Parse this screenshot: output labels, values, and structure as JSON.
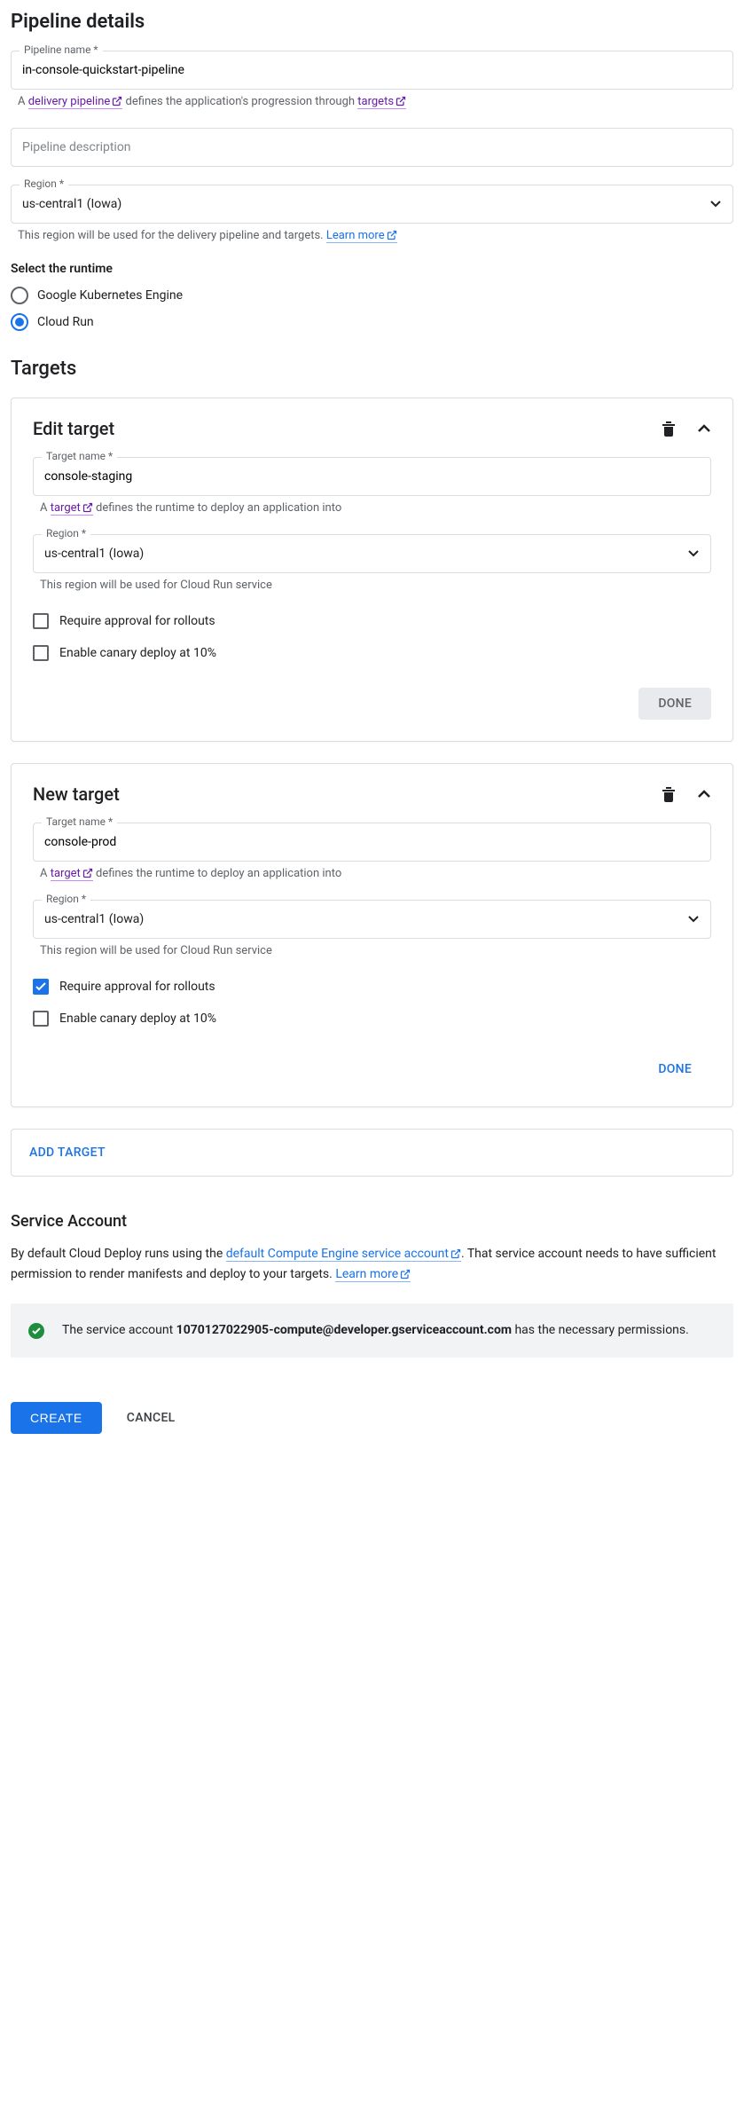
{
  "header": {
    "title": "Pipeline details"
  },
  "pipelineName": {
    "label": "Pipeline name *",
    "value": "in-console-quickstart-pipeline"
  },
  "pipelineHelper": {
    "prefix": "A ",
    "link1": "delivery pipeline",
    "mid": " defines the application's progression through ",
    "link2": "targets"
  },
  "pipelineDescription": {
    "placeholder": "Pipeline description"
  },
  "region": {
    "label": "Region *",
    "value": "us-central1 (Iowa)",
    "helperPrefix": "This region will be used for the delivery pipeline and targets. ",
    "helperLink": "Learn more"
  },
  "runtime": {
    "heading": "Select the runtime",
    "options": [
      {
        "label": "Google Kubernetes Engine",
        "selected": false
      },
      {
        "label": "Cloud Run",
        "selected": true
      }
    ]
  },
  "targetsHeading": "Targets",
  "targets": [
    {
      "cardTitle": "Edit target",
      "nameLabel": "Target name *",
      "nameValue": "console-staging",
      "helperPrefix": "A ",
      "helperLink": "target",
      "helperSuffix": " defines the runtime to deploy an application into",
      "regionLabel": "Region *",
      "regionValue": "us-central1 (Iowa)",
      "regionHelper": "This region will be used for Cloud Run service",
      "requireApproval": {
        "label": "Require approval for rollouts",
        "checked": false
      },
      "enableCanary": {
        "label": "Enable canary deploy at 10%",
        "checked": false
      },
      "doneLabel": "DONE",
      "doneDisabled": true
    },
    {
      "cardTitle": "New target",
      "nameLabel": "Target name *",
      "nameValue": "console-prod",
      "helperPrefix": "A ",
      "helperLink": "target",
      "helperSuffix": " defines the runtime to deploy an application into",
      "regionLabel": "Region *",
      "regionValue": "us-central1 (Iowa)",
      "regionHelper": "This region will be used for Cloud Run service",
      "requireApproval": {
        "label": "Require approval for rollouts",
        "checked": true
      },
      "enableCanary": {
        "label": "Enable canary deploy at 10%",
        "checked": false
      },
      "doneLabel": "DONE",
      "doneDisabled": false
    }
  ],
  "addTargetLabel": "ADD TARGET",
  "serviceAccount": {
    "heading": "Service Account",
    "textPrefix": "By default Cloud Deploy runs using the ",
    "link1": "default Compute Engine service account",
    "textMid": ". That service account needs to have sufficient permission to render manifests and deploy to your targets. ",
    "link2": "Learn more",
    "infoPrefix": "The service account ",
    "infoEmail": "1070127022905-compute@developer.gserviceaccount.com",
    "infoSuffix": " has the necessary permissions."
  },
  "footer": {
    "create": "CREATE",
    "cancel": "CANCEL"
  }
}
